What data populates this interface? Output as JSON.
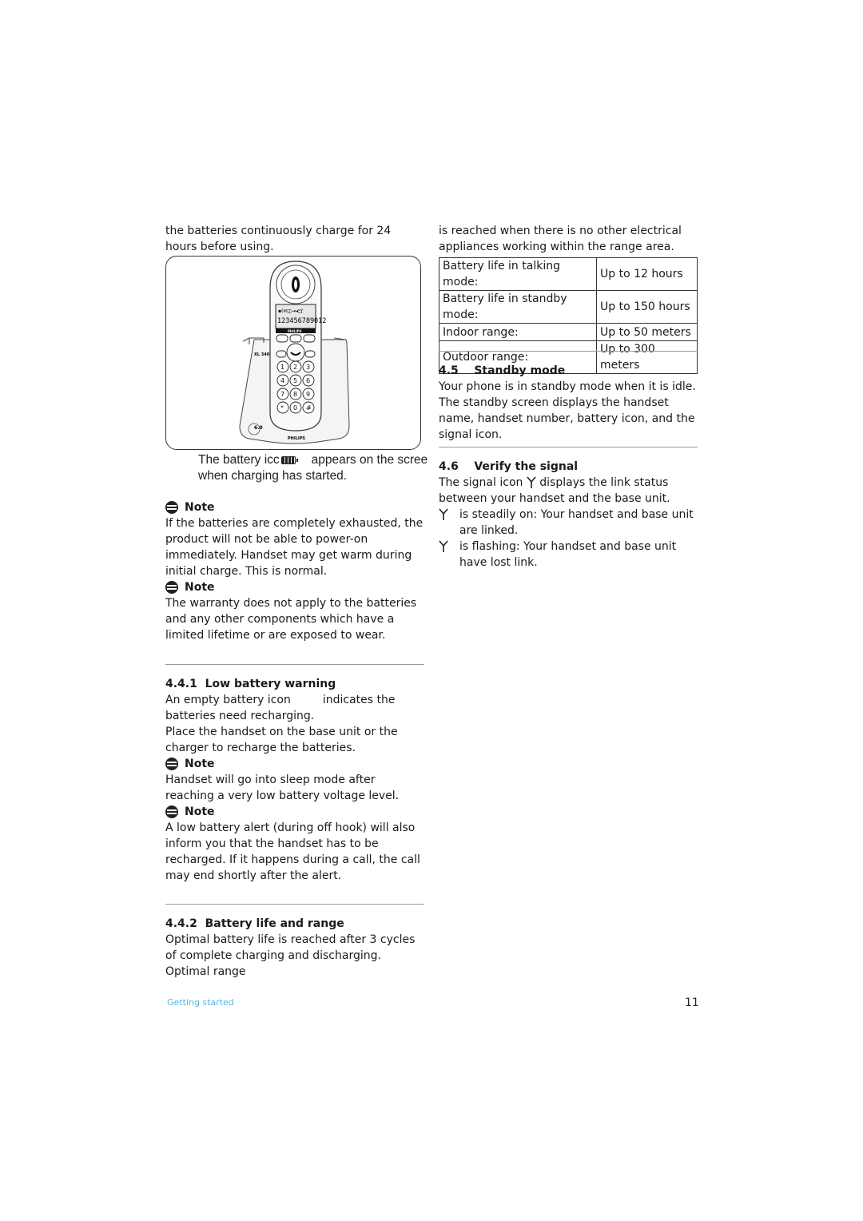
{
  "left_column": {
    "intro": "the batteries continuously charge for 24 hours before using.",
    "figure": {
      "handset_display_number": "123456789012",
      "handset_brand": "PHILIPS",
      "base_brand": "PHILIPS",
      "base_model": "XL 340",
      "base_badge": "6.0"
    },
    "caption_part1": "The battery icc",
    "caption_part2": "appears on the scree",
    "caption_line2": "when charging has started.",
    "notes_top": [
      {
        "title": "Note",
        "text": "If the batteries are completely exhausted, the product will not be able to power-on immediately. Handset may get warm during initial charge. This is normal."
      },
      {
        "title": "Note",
        "text": "The warranty does not apply to the batteries and any other components which have a limited lifetime or are exposed to wear."
      }
    ],
    "section_441": {
      "number": "4.4.1",
      "title": "Low battery warning",
      "line1_a": "An empty battery icon",
      "line1_b": "indicates the",
      "line2": "batteries need recharging.",
      "para2": "Place the handset on the base unit or the charger to recharge the batteries.",
      "notes": [
        {
          "title": "Note",
          "text": "Handset will go into sleep mode after reaching a very low battery voltage level."
        },
        {
          "title": "Note",
          "text": "A low battery alert (during off hook) will also inform you that the handset has to be recharged. If it happens during a call, the call may end shortly after the alert."
        }
      ]
    },
    "section_442": {
      "number": "4.4.2",
      "title": "Battery life and range",
      "text": "Optimal battery life is reached after 3 cycles of complete charging and discharging. Optimal range"
    }
  },
  "right_column": {
    "intro": "is reached when there is no other electrical appliances working within the range area.",
    "spec_table": [
      {
        "label": "Battery life in talking mode:",
        "value": "Up to 12 hours"
      },
      {
        "label": "Battery life in standby mode:",
        "value": "Up to 150 hours"
      },
      {
        "label": "Indoor range:",
        "value": "Up to 50 meters"
      },
      {
        "label": "Outdoor range:",
        "value": "Up to 300 meters"
      }
    ],
    "section_45": {
      "number": "4.5",
      "title": "Standby mode",
      "text": "Your phone is in standby mode when it is idle. The standby screen displays the handset name, handset number, battery icon, and the signal icon."
    },
    "section_46": {
      "number": "4.6",
      "title": "Verify the signal",
      "line1_a": "The signal icon",
      "line1_b": "displays the link status",
      "line2": "between your handset and the base unit.",
      "bullets": [
        {
          "icon": "signal-icon",
          "text": "is steadily on: Your handset and base unit are linked."
        },
        {
          "icon": "signal-icon",
          "text": "is flashing: Your handset and base unit have lost link."
        }
      ]
    }
  },
  "footer": {
    "section_name": "Getting started",
    "page_number": "11",
    "section_color": "#5ab4e6"
  }
}
